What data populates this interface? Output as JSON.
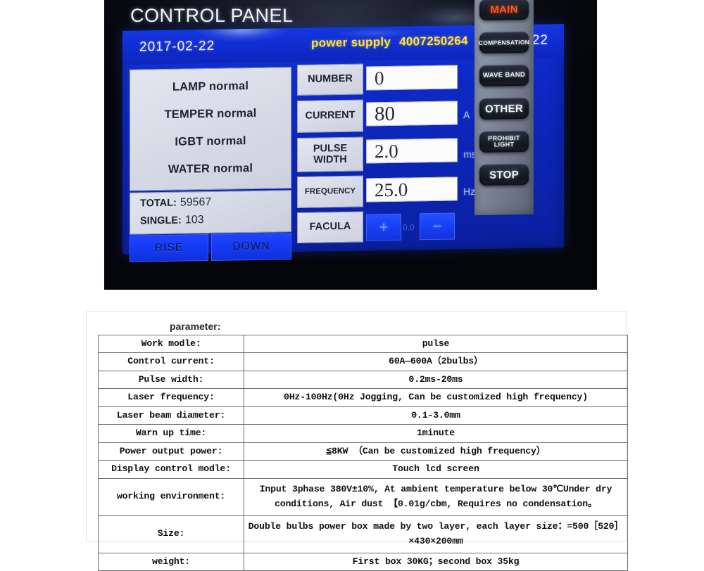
{
  "photo": {
    "title": "CONTROL PANEL",
    "header": {
      "date": "2017-02-22",
      "device_label": "power supply",
      "serial": "4007250264",
      "time": "17:22"
    },
    "status": {
      "lines": [
        "LAMP normal",
        "TEMPER normal",
        "IGBT normal",
        "WATER normal"
      ],
      "counters": [
        {
          "label": "TOTAL:",
          "value": "59567"
        },
        {
          "label": "SINGLE:",
          "value": "103"
        }
      ],
      "buttons": [
        {
          "label": "RISE"
        },
        {
          "label": "DOWN"
        }
      ]
    },
    "parameters": [
      {
        "label": "NUMBER",
        "value": "0",
        "unit": ""
      },
      {
        "label": "CURRENT",
        "value": "80",
        "unit": "A"
      },
      {
        "label": "PULSE WIDTH",
        "value": "2.0",
        "unit": "ms"
      },
      {
        "label": "FREQUENCY",
        "value": "25.0",
        "unit": "Hz"
      }
    ],
    "facula": {
      "label": "FACULA",
      "plus": "+",
      "minus": "−",
      "value": "0.0"
    },
    "side_buttons": [
      {
        "label": "MAIN",
        "accent": true
      },
      {
        "label": "COMPENSATION",
        "accent": false
      },
      {
        "label": "WAVE BAND",
        "accent": false
      },
      {
        "label": "OTHER",
        "accent": false
      },
      {
        "label": "PROHIBIT LIGHT",
        "accent": false
      },
      {
        "label": "STOP",
        "accent": false
      }
    ],
    "colors": {
      "lcd_blue": "#0f2bcc",
      "header_yellow": "#ffe636",
      "main_accent": "#ff5a1e",
      "panel_grey": "#d7dbe6"
    }
  },
  "spec_table": {
    "caption": "parameter:",
    "rows": [
      {
        "key": "Work modle:",
        "value": "pulse"
      },
      {
        "key": "Control current:",
        "value": "60A—600A（2bulbs）"
      },
      {
        "key": "Pulse width:",
        "value": "0.2ms-20ms"
      },
      {
        "key": "Laser frequency:",
        "value": "0Hz-100Hz(0Hz Jogging, Can be customized high frequency)"
      },
      {
        "key": "Laser beam diameter:",
        "value": "0.1-3.0mm"
      },
      {
        "key": "Warn up time:",
        "value": "1minute"
      },
      {
        "key": "Power output power:",
        "value": "≦8KW （Can be customized high frequency）"
      },
      {
        "key": "Display control modle:",
        "value": "Touch lcd screen"
      },
      {
        "key": "working environment:",
        "value": "Input 3phase 380V±10%, At ambient temperature below 30℃Under dry conditions, Air dust 【0.01g/cbm, Requires no condensation。"
      },
      {
        "key": "Size:",
        "value": "Double bulbs power box made by two layer, each layer size：=500［520］×430×200mm"
      },
      {
        "key": "weight:",
        "value": "First box 30KG；second box 35kg"
      }
    ]
  }
}
